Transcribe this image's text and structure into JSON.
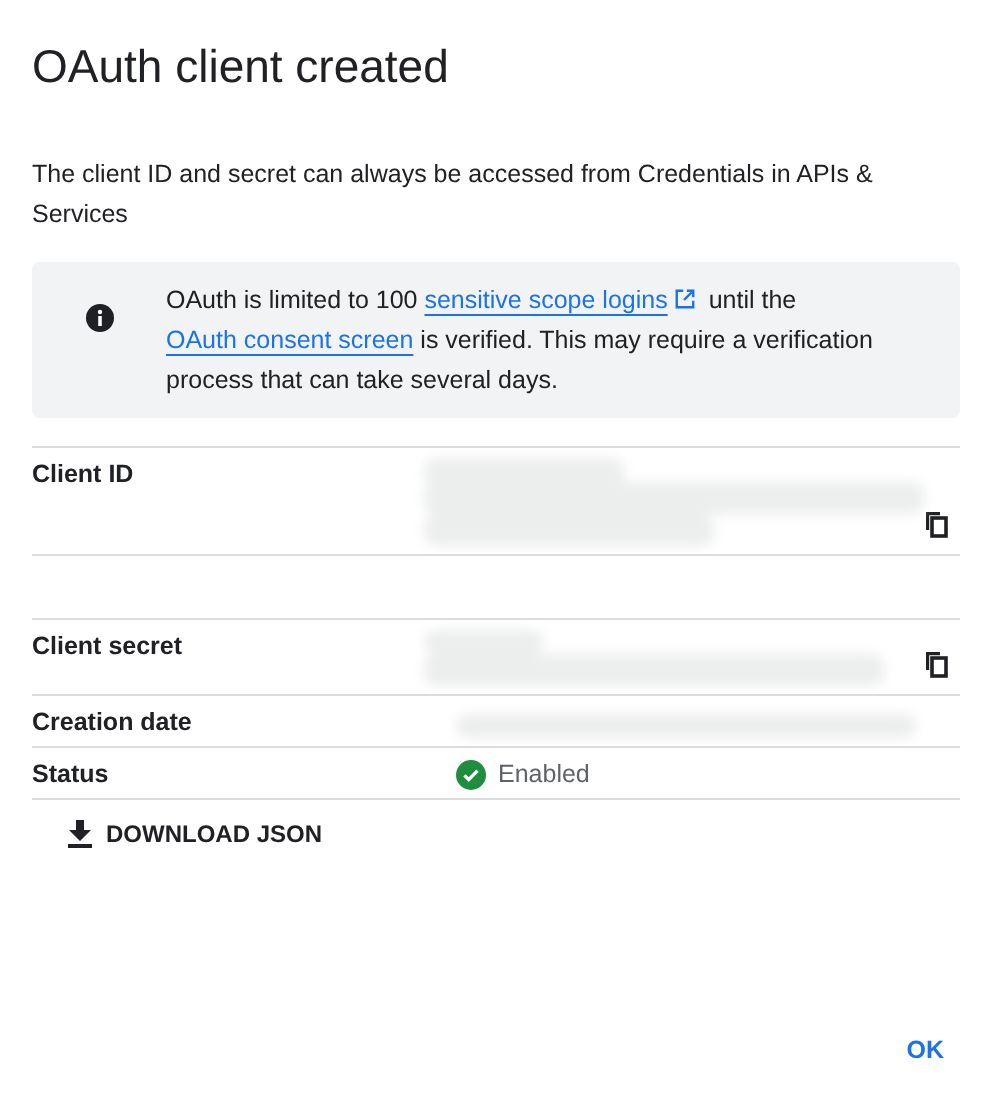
{
  "dialog": {
    "title": "OAuth client created",
    "description": "The client ID and secret can always be accessed from Credentials in APIs & Services"
  },
  "notice": {
    "text_before": "OAuth is limited to 100",
    "link_1": "sensitive scope logins",
    "link_1_external": true,
    "text_middle": "until the",
    "link_2": "OAuth consent screen",
    "text_after": "is verified. This may require a verification process that can take several days."
  },
  "rows": [
    {
      "kind": "redacted",
      "label": "Client ID",
      "copyable": true
    },
    {
      "kind": "spacer"
    },
    {
      "kind": "redacted",
      "label": "Client secret",
      "copyable": true
    },
    {
      "kind": "redacted",
      "label": "Creation date",
      "copyable": false
    },
    {
      "kind": "status",
      "label": "Status",
      "value": "Enabled",
      "enabled": true
    }
  ],
  "download_button": "DOWNLOAD JSON",
  "ok_button": "OK"
}
